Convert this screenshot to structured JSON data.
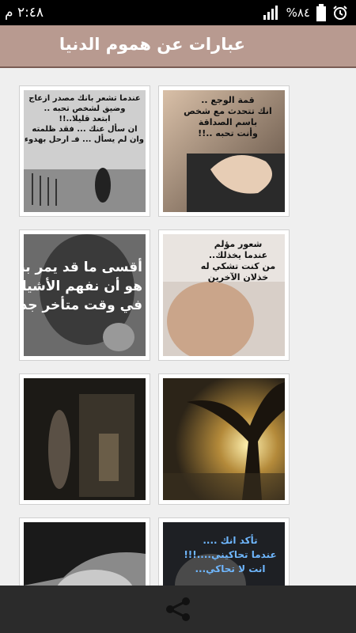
{
  "statusbar": {
    "time": "٢:٤٨ م",
    "battery": "%٨٤",
    "icons": [
      "alarm-icon",
      "signal-icon",
      "battery-icon"
    ]
  },
  "appbar": {
    "title": "عبارات عن هموم الدنيا"
  },
  "tiles": [
    {
      "text": "قمة الوجع ..\nانك تتحدث مع شخص\nباسم الصداقة\nوأنت تحبه ..!!"
    },
    {
      "text": "عندما تشعر بانك مصدر ازعاج\nوضيق لشخص تحبه ..\nابتعد قليلا..!!\nان سأل عنك ... فقد ظلمته\nوان لم يسأل ... فـ ارحل بهدوء"
    },
    {
      "text": "شعور مؤلم\nعندما يخذلك..\nمن كنت تشكي له\nخذلان الآخرين"
    },
    {
      "text": "أقسى ما قد يمر بنا\nهو أن نفهم الأشياء\nفي وقت متأخر جدا"
    },
    {
      "text": ""
    },
    {
      "text": ""
    },
    {
      "text": "تأكد انك ....\nعندما تحاكيني....!!!\nانت لا تحاكي..."
    },
    {
      "text": ""
    }
  ],
  "colors": {
    "appbar": "#b89a90",
    "bottombar": "#2b2b2b",
    "statusbar": "#000000"
  },
  "bottombar": {
    "icon": "share-icon"
  }
}
